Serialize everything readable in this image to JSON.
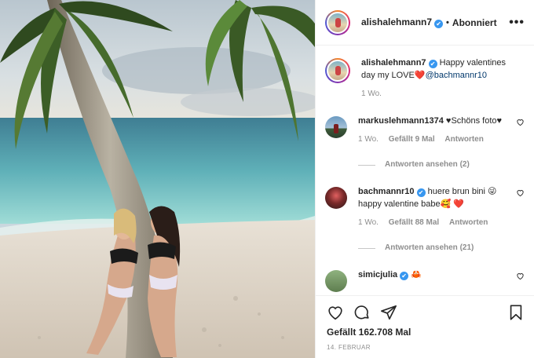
{
  "post": {
    "username": "alishalehmann7",
    "verified_mark": "✔",
    "separator": "•",
    "follow_state": "Abonniert",
    "more_label": "•••"
  },
  "caption": {
    "username": "alishalehmann7",
    "text": "Happy valentines day my LOVE",
    "emoji": "❤️",
    "mention": "@bachmannr10",
    "age": "1 Wo."
  },
  "comments": [
    {
      "username": "markuslehmann1374",
      "text": "♥Schöns foto♥",
      "age": "1 Wo.",
      "likes": "Gefällt 9 Mal",
      "reply": "Antworten",
      "view_replies": "Antworten ansehen (2)"
    },
    {
      "username": "bachmannr10",
      "text": "huere brun bini 😜 happy valentine babe🥰 ❤️",
      "age": "1 Wo.",
      "likes": "Gefällt 88 Mal",
      "reply": "Antworten",
      "view_replies": "Antworten ansehen (21)"
    },
    {
      "username": "simicjulia",
      "text": "🦀"
    }
  ],
  "actions": {
    "likes": "Gefällt 162.708 Mal",
    "date": "14. FEBRUAR"
  },
  "icons": [
    "heart-icon",
    "comment-icon",
    "share-icon",
    "bookmark-icon",
    "more-icon",
    "verified-icon"
  ],
  "colors": {
    "verified": "#3897f0",
    "mention": "#00376b",
    "heart_emoji": "#ed4956",
    "secondary_text": "#8e8e8e"
  }
}
